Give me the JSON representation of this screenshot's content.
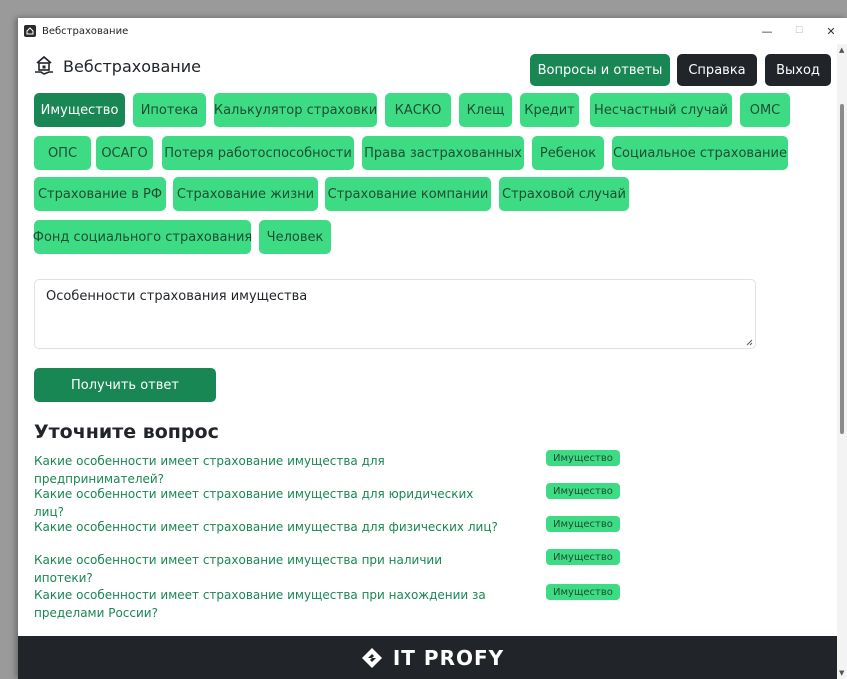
{
  "window": {
    "title": "Вебстрахование",
    "controls": {
      "minimize": "—",
      "maximize": "☐",
      "close": "✕"
    }
  },
  "header": {
    "brand": "Вебстрахование",
    "buttons": {
      "faq": "Вопросы и ответы",
      "help": "Справка",
      "logout": "Выход"
    }
  },
  "categories": [
    "Имущество",
    "Ипотека",
    "Калькулятор страховки",
    "КАСКО",
    "Клещ",
    "Кредит",
    "Несчастный случай",
    "ОМС",
    "ОПС",
    "ОСАГО",
    "Потеря работоспособности",
    "Права застрахованных",
    "Ребенок",
    "Социальное страхование",
    "Страхование в РФ",
    "Страхование жизни",
    "Страхование компании",
    "Страховой случай",
    "Фонд социального страхования",
    "Человек"
  ],
  "active_category": "Имущество",
  "question": {
    "value": "Особенности страхования имущества"
  },
  "get_answer_label": "Получить ответ",
  "refine": {
    "title": "Уточните вопрос",
    "suggestions": [
      {
        "text": "Какие особенности имеет страхование имущества для предпринимателей?",
        "tag": "Имущество"
      },
      {
        "text": "Какие особенности имеет страхование имущества для юридических лиц?",
        "tag": "Имущество"
      },
      {
        "text": "Какие особенности имеет страхование имущества для физических лиц?",
        "tag": "Имущество"
      },
      {
        "text": "Какие особенности имеет страхование имущества при наличии ипотеки?",
        "tag": "Имущество"
      },
      {
        "text": "Какие особенности имеет страхование имущества при нахождении за пределами России?",
        "tag": "Имущество"
      }
    ]
  },
  "footer": {
    "brand": "IT PROFY"
  },
  "colors": {
    "primary": "#198754",
    "accent": "#3ddc84",
    "dark": "#212529"
  },
  "icons": {
    "logo": "house-hand-icon",
    "footer_logo": "diamond-logo-icon"
  }
}
